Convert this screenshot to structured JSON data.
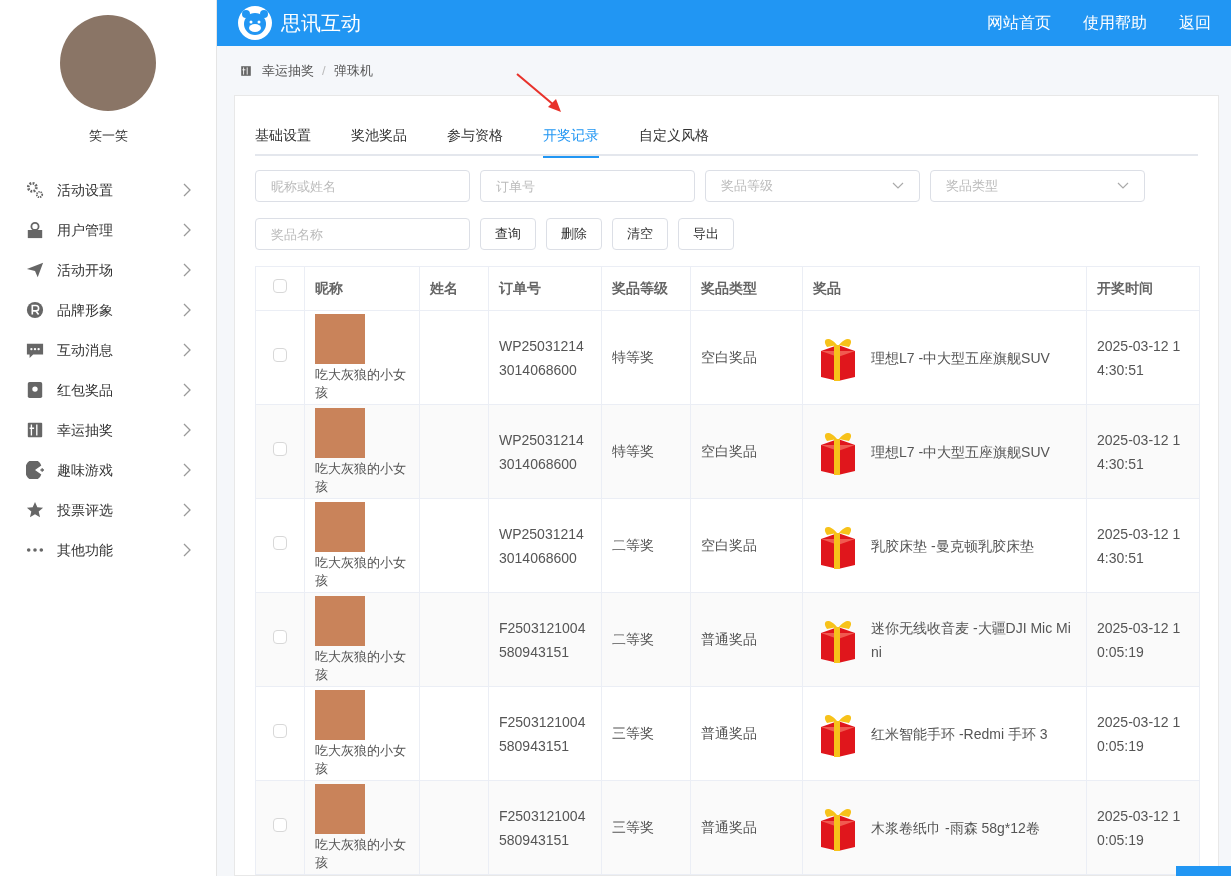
{
  "sidebar": {
    "user_name": "笑一笑",
    "menu": [
      {
        "label": "活动设置"
      },
      {
        "label": "用户管理"
      },
      {
        "label": "活动开场"
      },
      {
        "label": "品牌形象"
      },
      {
        "label": "互动消息"
      },
      {
        "label": "红包奖品"
      },
      {
        "label": "幸运抽奖"
      },
      {
        "label": "趣味游戏"
      },
      {
        "label": "投票评选"
      },
      {
        "label": "其他功能"
      }
    ]
  },
  "header": {
    "logo_text": "思讯互动",
    "links": [
      "网站首页",
      "使用帮助",
      "返回"
    ]
  },
  "breadcrumb": {
    "items": [
      "幸运抽奖",
      "弹珠机"
    ],
    "separator": "/"
  },
  "tabs": [
    {
      "label": "基础设置",
      "selected": false
    },
    {
      "label": "奖池奖品",
      "selected": false
    },
    {
      "label": "参与资格",
      "selected": false
    },
    {
      "label": "开奖记录",
      "selected": true
    },
    {
      "label": "自定义风格",
      "selected": false
    }
  ],
  "filters": [
    {
      "kind": "input",
      "placeholder": "昵称或姓名"
    },
    {
      "kind": "input",
      "placeholder": "订单号"
    },
    {
      "kind": "select",
      "placeholder": "奖品等级"
    },
    {
      "kind": "select",
      "placeholder": "奖品类型"
    },
    {
      "kind": "input",
      "placeholder": "奖品名称"
    }
  ],
  "buttons": [
    "查询",
    "删除",
    "清空",
    "导出"
  ],
  "table": {
    "all_checked": false,
    "columns": [
      "昵称",
      "姓名",
      "订单号",
      "奖品等级",
      "奖品类型",
      "奖品",
      "开奖时间"
    ],
    "rows": [
      {
        "checked": false,
        "nickname": "吃大灰狼的小女孩",
        "order_no": "WP250312143014068600",
        "level": "特等奖",
        "type": "空白奖品",
        "prize": "理想L7 -中大型五座旗舰SUV",
        "time": "2025-03-12 14:30:51"
      },
      {
        "checked": false,
        "nickname": "吃大灰狼的小女孩",
        "order_no": "WP250312143014068600",
        "level": "特等奖",
        "type": "空白奖品",
        "prize": "理想L7 -中大型五座旗舰SUV",
        "time": "2025-03-12 14:30:51"
      },
      {
        "checked": false,
        "nickname": "吃大灰狼的小女孩",
        "order_no": "WP250312143014068600",
        "level": "二等奖",
        "type": "空白奖品",
        "prize": "乳胶床垫 -曼克顿乳胶床垫",
        "time": "2025-03-12 14:30:51"
      },
      {
        "checked": false,
        "nickname": "吃大灰狼的小女孩",
        "order_no": "F2503121004580943151",
        "level": "二等奖",
        "type": "普通奖品",
        "prize": "迷你无线收音麦 -大疆DJI Mic Mini",
        "time": "2025-03-12 10:05:19"
      },
      {
        "checked": false,
        "nickname": "吃大灰狼的小女孩",
        "order_no": "F2503121004580943151",
        "level": "三等奖",
        "type": "普通奖品",
        "prize": "红米智能手环 -Redmi 手环 3",
        "time": "2025-03-12 10:05:19"
      },
      {
        "checked": false,
        "nickname": "吃大灰狼的小女孩",
        "order_no": "F2503121004580943151",
        "level": "三等奖",
        "type": "普通奖品",
        "prize": "木浆卷纸巾 -雨森 58g*12卷",
        "time": "2025-03-12 10:05:19"
      }
    ]
  }
}
